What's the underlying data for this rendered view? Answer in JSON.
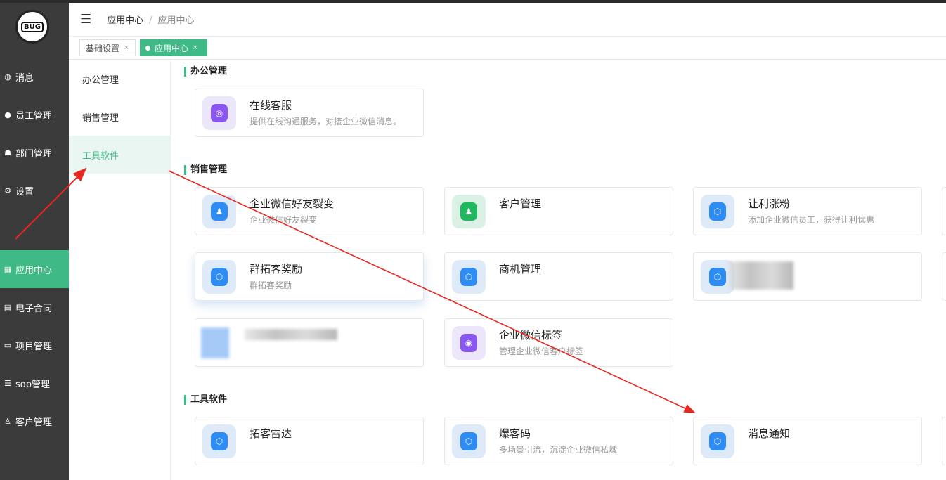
{
  "logo_text": "BUG",
  "sidebar": {
    "items": [
      {
        "label": "消息",
        "icon": "message-icon"
      },
      {
        "label": "员工管理",
        "icon": "user-icon"
      },
      {
        "label": "部门管理",
        "icon": "org-icon"
      },
      {
        "label": "设置",
        "icon": "gear-icon"
      },
      {
        "label": "应用中心",
        "icon": "apps-icon"
      },
      {
        "label": "电子合同",
        "icon": "contract-icon"
      },
      {
        "label": "项目管理",
        "icon": "project-icon"
      },
      {
        "label": "sop管理",
        "icon": "database-icon"
      },
      {
        "label": "客户管理",
        "icon": "customer-icon"
      }
    ]
  },
  "breadcrumb": {
    "first": "应用中心",
    "sep": "/",
    "current": "应用中心"
  },
  "tabs": [
    {
      "label": "基础设置",
      "close": "×"
    },
    {
      "label": "应用中心",
      "close": "×"
    }
  ],
  "subnav": [
    "办公管理",
    "销售管理",
    "工具软件"
  ],
  "sections": {
    "office": {
      "title": "办公管理",
      "cards": [
        {
          "title": "在线客服",
          "desc": "提供在线沟通服务，对接企业微信消息。"
        }
      ]
    },
    "sales": {
      "title": "销售管理",
      "cards": [
        {
          "title": "企业微信好友裂变",
          "desc": "企业微信好友裂变"
        },
        {
          "title": "客户管理",
          "desc": ""
        },
        {
          "title": "让利涨粉",
          "desc": "添加企业微信员工，获得让利优惠"
        },
        {
          "title": "群拓客奖励",
          "desc": "群拓客奖励"
        },
        {
          "title": "商机管理",
          "desc": ""
        },
        {
          "title": "企业微信标签",
          "desc": "管理企业微信客户标签"
        }
      ]
    },
    "tools": {
      "title": "工具软件",
      "cards": [
        {
          "title": "拓客雷达",
          "desc": ""
        },
        {
          "title": "爆客码",
          "desc": "多场景引流，沉淀企业微信私域"
        },
        {
          "title": "消息通知",
          "desc": ""
        }
      ]
    }
  },
  "colors": {
    "accent": "#3fb985",
    "sidebar": "#3b3b3b",
    "arrow": "#e8281e"
  }
}
